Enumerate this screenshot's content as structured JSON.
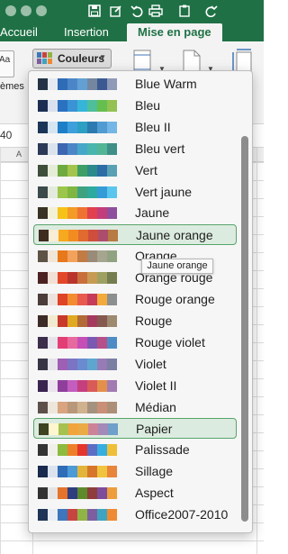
{
  "ribbon": {
    "tabs": [
      {
        "label": "Accueil"
      },
      {
        "label": "Insertion"
      },
      {
        "label": "Mise en page"
      }
    ],
    "themes_label": "èmes",
    "couleurs_button": "Couleurs",
    "font_preview": "Aa",
    "cell_ref": "40",
    "column_a": "A"
  },
  "menu": {
    "items": [
      {
        "label": "Blue Warm",
        "colors": [
          "#243446",
          "#e6ebf2",
          "#2f6cb6",
          "#4c86c8",
          "#62a0d3",
          "#7486a0",
          "#3c5a92",
          "#8f99b8"
        ]
      },
      {
        "label": "Bleu",
        "colors": [
          "#1c2f53",
          "#d9e1ee",
          "#2a71c0",
          "#3993d4",
          "#35b6d9",
          "#4fbe9a",
          "#65bf4e",
          "#93c152"
        ]
      },
      {
        "label": "Bleu II",
        "colors": [
          "#1b3556",
          "#d6e5f2",
          "#1e7fc8",
          "#3da0dc",
          "#2d9fc2",
          "#2c7ab0",
          "#4f9bd2",
          "#74b6e5"
        ]
      },
      {
        "label": "Bleu vert",
        "colors": [
          "#2d3a56",
          "#dde3ed",
          "#3f66b0",
          "#4b87c8",
          "#45a8c8",
          "#48b5ae",
          "#52b595",
          "#3f8f88"
        ]
      },
      {
        "label": "Vert",
        "colors": [
          "#3e4e3a",
          "#e5ecd8",
          "#6eaa3f",
          "#a4c44d",
          "#3f9e66",
          "#2d8a8a",
          "#2c6da6",
          "#5aa0b4"
        ]
      },
      {
        "label": "Vert jaune",
        "colors": [
          "#3c4a4a",
          "#e4eade",
          "#9bc64b",
          "#7fb641",
          "#3ea27f",
          "#2da9a0",
          "#349bd6",
          "#5bc6ed"
        ]
      },
      {
        "label": "Jaune",
        "colors": [
          "#3a3324",
          "#f3f0d8",
          "#f5c318",
          "#f49a26",
          "#ee7231",
          "#e0404f",
          "#c33d7a",
          "#8e4e9e"
        ]
      },
      {
        "label": "Jaune orange",
        "colors": [
          "#3e2d1f",
          "#f8edd5",
          "#f6a81e",
          "#f28c22",
          "#e06a2f",
          "#cf4d3c",
          "#ad4d6c",
          "#b77a42"
        ]
      },
      {
        "label": "Orange",
        "colors": [
          "#5d5346",
          "#efe6d8",
          "#e8781c",
          "#f2a25b",
          "#c37b44",
          "#9a8a78",
          "#a6a590",
          "#8fa380"
        ]
      },
      {
        "label": "Orange rouge",
        "colors": [
          "#4c2222",
          "#f2dfd5",
          "#e2472a",
          "#b9342c",
          "#c86f3c",
          "#c79b53",
          "#9ea063",
          "#757d50"
        ]
      },
      {
        "label": "Rouge orange",
        "colors": [
          "#4a3d3a",
          "#ece3df",
          "#e04426",
          "#f28b32",
          "#e85a4d",
          "#c63c58",
          "#f2aa3c",
          "#8c8f90"
        ]
      },
      {
        "label": "Rouge",
        "colors": [
          "#3c2b26",
          "#f2ead0",
          "#c8392b",
          "#e1a824",
          "#b26a36",
          "#a43b5e",
          "#85594f",
          "#9d8a6f"
        ]
      },
      {
        "label": "Rouge violet",
        "colors": [
          "#3c2d4b",
          "#e7e3ec",
          "#e23f75",
          "#e76a9f",
          "#c54fb6",
          "#7b59b2",
          "#b6508a",
          "#4f8cc6"
        ]
      },
      {
        "label": "Violet",
        "colors": [
          "#373545",
          "#e5e4ec",
          "#9e5fb4",
          "#7b74c4",
          "#6b8bd0",
          "#5ea6cf",
          "#977bb6",
          "#7b7fa3"
        ]
      },
      {
        "label": "Violet II",
        "colors": [
          "#3a2450",
          "#ebe3ef",
          "#8f3f9b",
          "#c35dbf",
          "#c53f7f",
          "#d95b58",
          "#e48f4a",
          "#a27bb2"
        ]
      },
      {
        "label": "Médian",
        "colors": [
          "#5d504b",
          "#ece6dc",
          "#d9a47f",
          "#b9977a",
          "#d0b28f",
          "#a5927e",
          "#c98f77",
          "#ad8f78"
        ]
      },
      {
        "label": "Papier",
        "colors": [
          "#3e4322",
          "#fff6d0",
          "#a6c14f",
          "#f2a43c",
          "#eaaa44",
          "#cd8397",
          "#a38ab8",
          "#6fa0c9"
        ]
      },
      {
        "label": "Palissade",
        "colors": [
          "#343434",
          "#f1efea",
          "#8dbb3f",
          "#ee7f2a",
          "#e3362c",
          "#5b6ec4",
          "#37aee0",
          "#f0bf3a"
        ]
      },
      {
        "label": "Sillage",
        "colors": [
          "#192a4c",
          "#dbe3ef",
          "#2f6db6",
          "#4c9ad6",
          "#e2b53a",
          "#d7762a",
          "#f0c43f",
          "#e8853b"
        ]
      },
      {
        "label": "Aspect",
        "colors": [
          "#323232",
          "#e4e4e4",
          "#e4742b",
          "#2f3e7e",
          "#5e8a2c",
          "#8f3c3c",
          "#7d4c9a",
          "#ee9d3d"
        ]
      },
      {
        "label": "Office2007-2010",
        "colors": [
          "#1e3556",
          "#e9eef4",
          "#3d76ba",
          "#c64541",
          "#91b446",
          "#7d5fa0",
          "#3ea4c1",
          "#ef8a32"
        ]
      }
    ],
    "selected_items": [
      "Jaune orange",
      "Papier"
    ]
  },
  "tooltip": {
    "text": "Jaune orange"
  }
}
